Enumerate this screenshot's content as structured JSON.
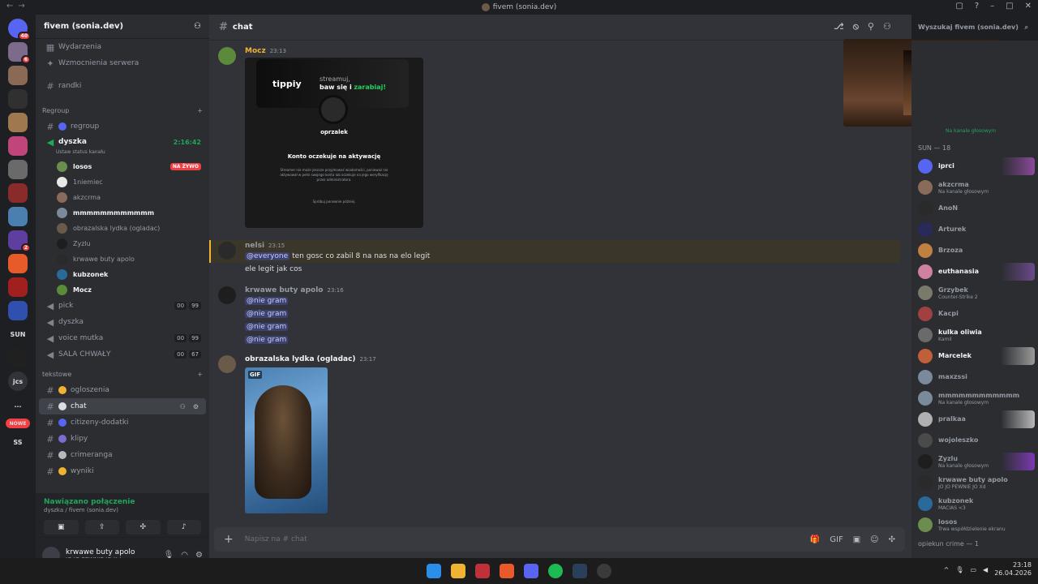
{
  "window": {
    "title": "fivem (sonia.dev)"
  },
  "server": {
    "name": "fivem (sonia.dev)"
  },
  "guilds": [
    {
      "label": "",
      "color": "#5865f2",
      "badge": "40"
    },
    {
      "label": "",
      "color": "#7d6b8c",
      "badge": "6"
    },
    {
      "label": "",
      "color": "#8a6a55",
      "badge": ""
    },
    {
      "label": "",
      "color": "#303030",
      "badge": ""
    },
    {
      "label": "",
      "color": "#a07850",
      "badge": ""
    },
    {
      "label": "",
      "color": "#c0457a",
      "badge": ""
    },
    {
      "label": "",
      "color": "#6a6a6a",
      "badge": ""
    },
    {
      "label": "",
      "color": "#8a2b2b",
      "badge": ""
    },
    {
      "label": "",
      "color": "#4a7fb0",
      "badge": ""
    },
    {
      "label": "",
      "color": "#5e3fa0",
      "badge": "2"
    },
    {
      "label": "",
      "color": "#e85a2a",
      "badge": ""
    },
    {
      "label": "",
      "color": "#a02020",
      "badge": ""
    },
    {
      "label": "",
      "color": "#3050b0",
      "badge": ""
    },
    {
      "label": "SUN",
      "color": "#1e1f22",
      "badge": ""
    },
    {
      "label": "",
      "color": "#202020",
      "badge": ""
    },
    {
      "label": "jcs",
      "color": "#313338",
      "badge": ""
    },
    {
      "label": "...",
      "color": "#1e1f22",
      "badge": ""
    },
    {
      "label": "SS",
      "color": "#1e1f22",
      "badge": ""
    }
  ],
  "nowe_label": "NOWE",
  "channels": {
    "top": [
      {
        "icon": "calendar",
        "label": "Wydarzenia"
      },
      {
        "icon": "boost",
        "label": "Wzmocnienia serwera"
      }
    ],
    "randki": "randki",
    "regroup_category": "Regroup",
    "regroup": "regroup",
    "dyszka": {
      "label": "dyszka",
      "timer": "2:16:42",
      "status": "Ustaw status kanału"
    },
    "voice_users": [
      {
        "name": "losos",
        "live": "NA ŻYWO",
        "bold": true,
        "color": "#6b8e4e"
      },
      {
        "name": "1niemiec",
        "bold": false,
        "color": "#e8e8e8"
      },
      {
        "name": "akzcrma",
        "bold": false,
        "color": "#8a6a5a"
      },
      {
        "name": "mmmmmmmmmmmm",
        "bold": true,
        "color": "#7a8a9a"
      },
      {
        "name": "obrazalska lydka (ogladac)",
        "bold": false,
        "color": "#6a5a4a"
      },
      {
        "name": "Zyzlu",
        "bold": false,
        "color": "#1e1e1e"
      },
      {
        "name": "krwawe buty apolo",
        "bold": false,
        "color": "#2a2a2a"
      },
      {
        "name": "kubzonek",
        "bold": true,
        "color": "#2a6a9a"
      },
      {
        "name": "Mocz",
        "bold": true,
        "color": "#5a8a3a"
      }
    ],
    "voice_channels": [
      {
        "label": "pick",
        "a": "00",
        "b": "99"
      },
      {
        "label": "dyszka",
        "a": "",
        "b": ""
      },
      {
        "label": "voice mutka",
        "a": "00",
        "b": "99"
      },
      {
        "label": "SALA CHWAŁY",
        "a": "00",
        "b": "67"
      }
    ],
    "tekstowe_category": "tekstowe",
    "text_channels": [
      {
        "label": "ogloszenia",
        "selected": false,
        "color": "#f0b232"
      },
      {
        "label": "chat",
        "selected": true,
        "color": "#dbdee1"
      },
      {
        "label": "citizeny-dodatki",
        "selected": false,
        "color": "#5865f2"
      },
      {
        "label": "klipy",
        "selected": false,
        "color": "#7d6bd0"
      },
      {
        "label": "crimeranga",
        "selected": false,
        "color": "#b5bac1"
      },
      {
        "label": "wyniki",
        "selected": false,
        "color": "#f0b232"
      }
    ]
  },
  "voice_panel": {
    "status": "Nawiązano połączenie",
    "location": "dyszka / fivem (sonia.dev)"
  },
  "user": {
    "name": "krwawe buty apolo",
    "status": "JO JO PEWNIE JO Xd"
  },
  "chat": {
    "channel": "chat",
    "search_placeholder": "Wyszukaj fivem (sonia.dev)",
    "composer_placeholder": "Napisz na #",
    "composer_channel": "chat"
  },
  "messages": [
    {
      "author": "Mocz",
      "time": "23:13"
    },
    {
      "author": "nelsi",
      "time": "23:15",
      "lines": [
        "@everyone ten gosc co zabil 8 na nas na elo legit",
        "ele legit jak cos"
      ]
    },
    {
      "author": "krwawe buty apolo",
      "time": "23:16",
      "lines": [
        "@nie gram",
        "@nie gram",
        "@nie gram",
        "@nie gram"
      ]
    },
    {
      "author": "obrazalska lydka (ogladac)",
      "time": "23:17",
      "gif_label": "GIF"
    }
  ],
  "embed": {
    "logo": "tippiy",
    "tag1": "streamuj,",
    "tag2": "baw się i",
    "tag3": "zarabiaj!",
    "profile": "oprzalek",
    "title": "Konto oczekuje na aktywację",
    "desc": "Streamer nie może jeszcze przyjmować wiadomości, ponieważ nie aktywował w pełni swojego konta lub oczekuje na jego weryfikację przez administratora.",
    "retry": "Spróbuj ponownie później."
  },
  "members": {
    "group1": "SUN — 18",
    "top_status": "Na kanale głosowym",
    "list": [
      {
        "name": "iprci",
        "status": "",
        "color": "#5865f2",
        "bright": true,
        "bg": "#8a4a9a"
      },
      {
        "name": "akzcrma",
        "status": "Na kanale głosowym",
        "color": "#8a6a5a"
      },
      {
        "name": "AnoN",
        "status": "",
        "color": "#2a2a2a"
      },
      {
        "name": "Arturek",
        "status": "",
        "color": "#2a2a5a"
      },
      {
        "name": "Brzoza",
        "status": "",
        "color": "#c08040"
      },
      {
        "name": "euthanasia",
        "status": "",
        "color": "#d080a0",
        "bright": true,
        "bg": "#6a4a8a"
      },
      {
        "name": "Grzybek",
        "status": "Counter-Strike 2",
        "color": "#7a7a6a"
      },
      {
        "name": "Kacpi",
        "status": "",
        "color": "#a04040"
      },
      {
        "name": "kulka oliwia",
        "status": "Kamil",
        "color": "#6a6a6a",
        "bright": true
      },
      {
        "name": "Marcelek",
        "status": "",
        "color": "#c0603a",
        "bright": true,
        "bg": "#9a9a9a"
      },
      {
        "name": "maxzssi",
        "status": "",
        "color": "#7a8a9a"
      },
      {
        "name": "mmmmmmmmmmmm",
        "status": "Na kanale głosowym",
        "color": "#7a8a9a"
      },
      {
        "name": "pralkaa",
        "status": "",
        "color": "#b0b0b0",
        "bg": "#b8b8b8"
      },
      {
        "name": "wojoleszko",
        "status": "",
        "color": "#4a4a4a"
      },
      {
        "name": "Zyzlu",
        "status": "Na kanale głosowym",
        "color": "#1e1e1e",
        "bg": "#7a3ab0"
      },
      {
        "name": "krwawe buty apolo",
        "status": "JO JO PEWNIE JO Xd",
        "color": "#2a2a2a"
      },
      {
        "name": "kubzonek",
        "status": "MACIAS <3",
        "color": "#2a6a9a"
      },
      {
        "name": "losos",
        "status": "Trwa współdzielenie ekranu",
        "color": "#6b8e4e"
      }
    ],
    "group2": "opiekun crime — 1"
  },
  "taskbar": {
    "time": "23:18",
    "date": "26.04.2026"
  }
}
